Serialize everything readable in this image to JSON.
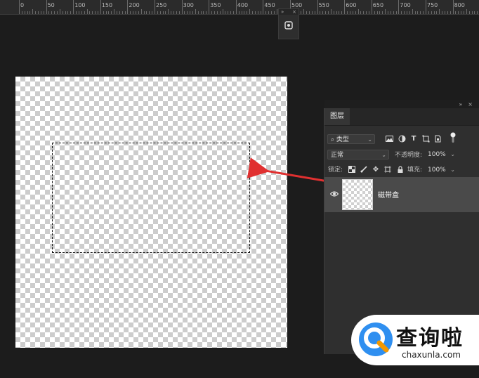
{
  "ruler": {
    "labels": [
      "0",
      "50",
      "100",
      "150",
      "200",
      "250",
      "300",
      "350",
      "400",
      "450",
      "500",
      "550",
      "600",
      "650",
      "700",
      "750",
      "800"
    ]
  },
  "floating_panel": {
    "icon": "adjustments-icon"
  },
  "layers_panel": {
    "tab_label": "图层",
    "filter_kind": "类型",
    "filter_icons": [
      "image-filter-icon",
      "adjustment-filter-icon",
      "type-filter-icon",
      "shape-filter-icon",
      "smart-object-filter-icon",
      "filter-toggle-icon"
    ],
    "blend_mode": "正常",
    "opacity_label": "不透明度:",
    "opacity_value": "100%",
    "lock_label": "锁定:",
    "lock_icons": [
      "lock-transparent-icon",
      "lock-image-icon",
      "lock-position-icon",
      "lock-artboard-icon",
      "lock-all-icon"
    ],
    "fill_label": "填充:",
    "fill_value": "100%",
    "layer": {
      "name": "磁带盒",
      "visible": true
    }
  },
  "annotation": {
    "arrow_color": "#e03030",
    "ellipse_color": "#d12b2b"
  },
  "watermark": {
    "title": "查询啦",
    "url": "chaxunla.com",
    "logo_color": "#2f8ff0",
    "accent_color": "#f39800"
  }
}
